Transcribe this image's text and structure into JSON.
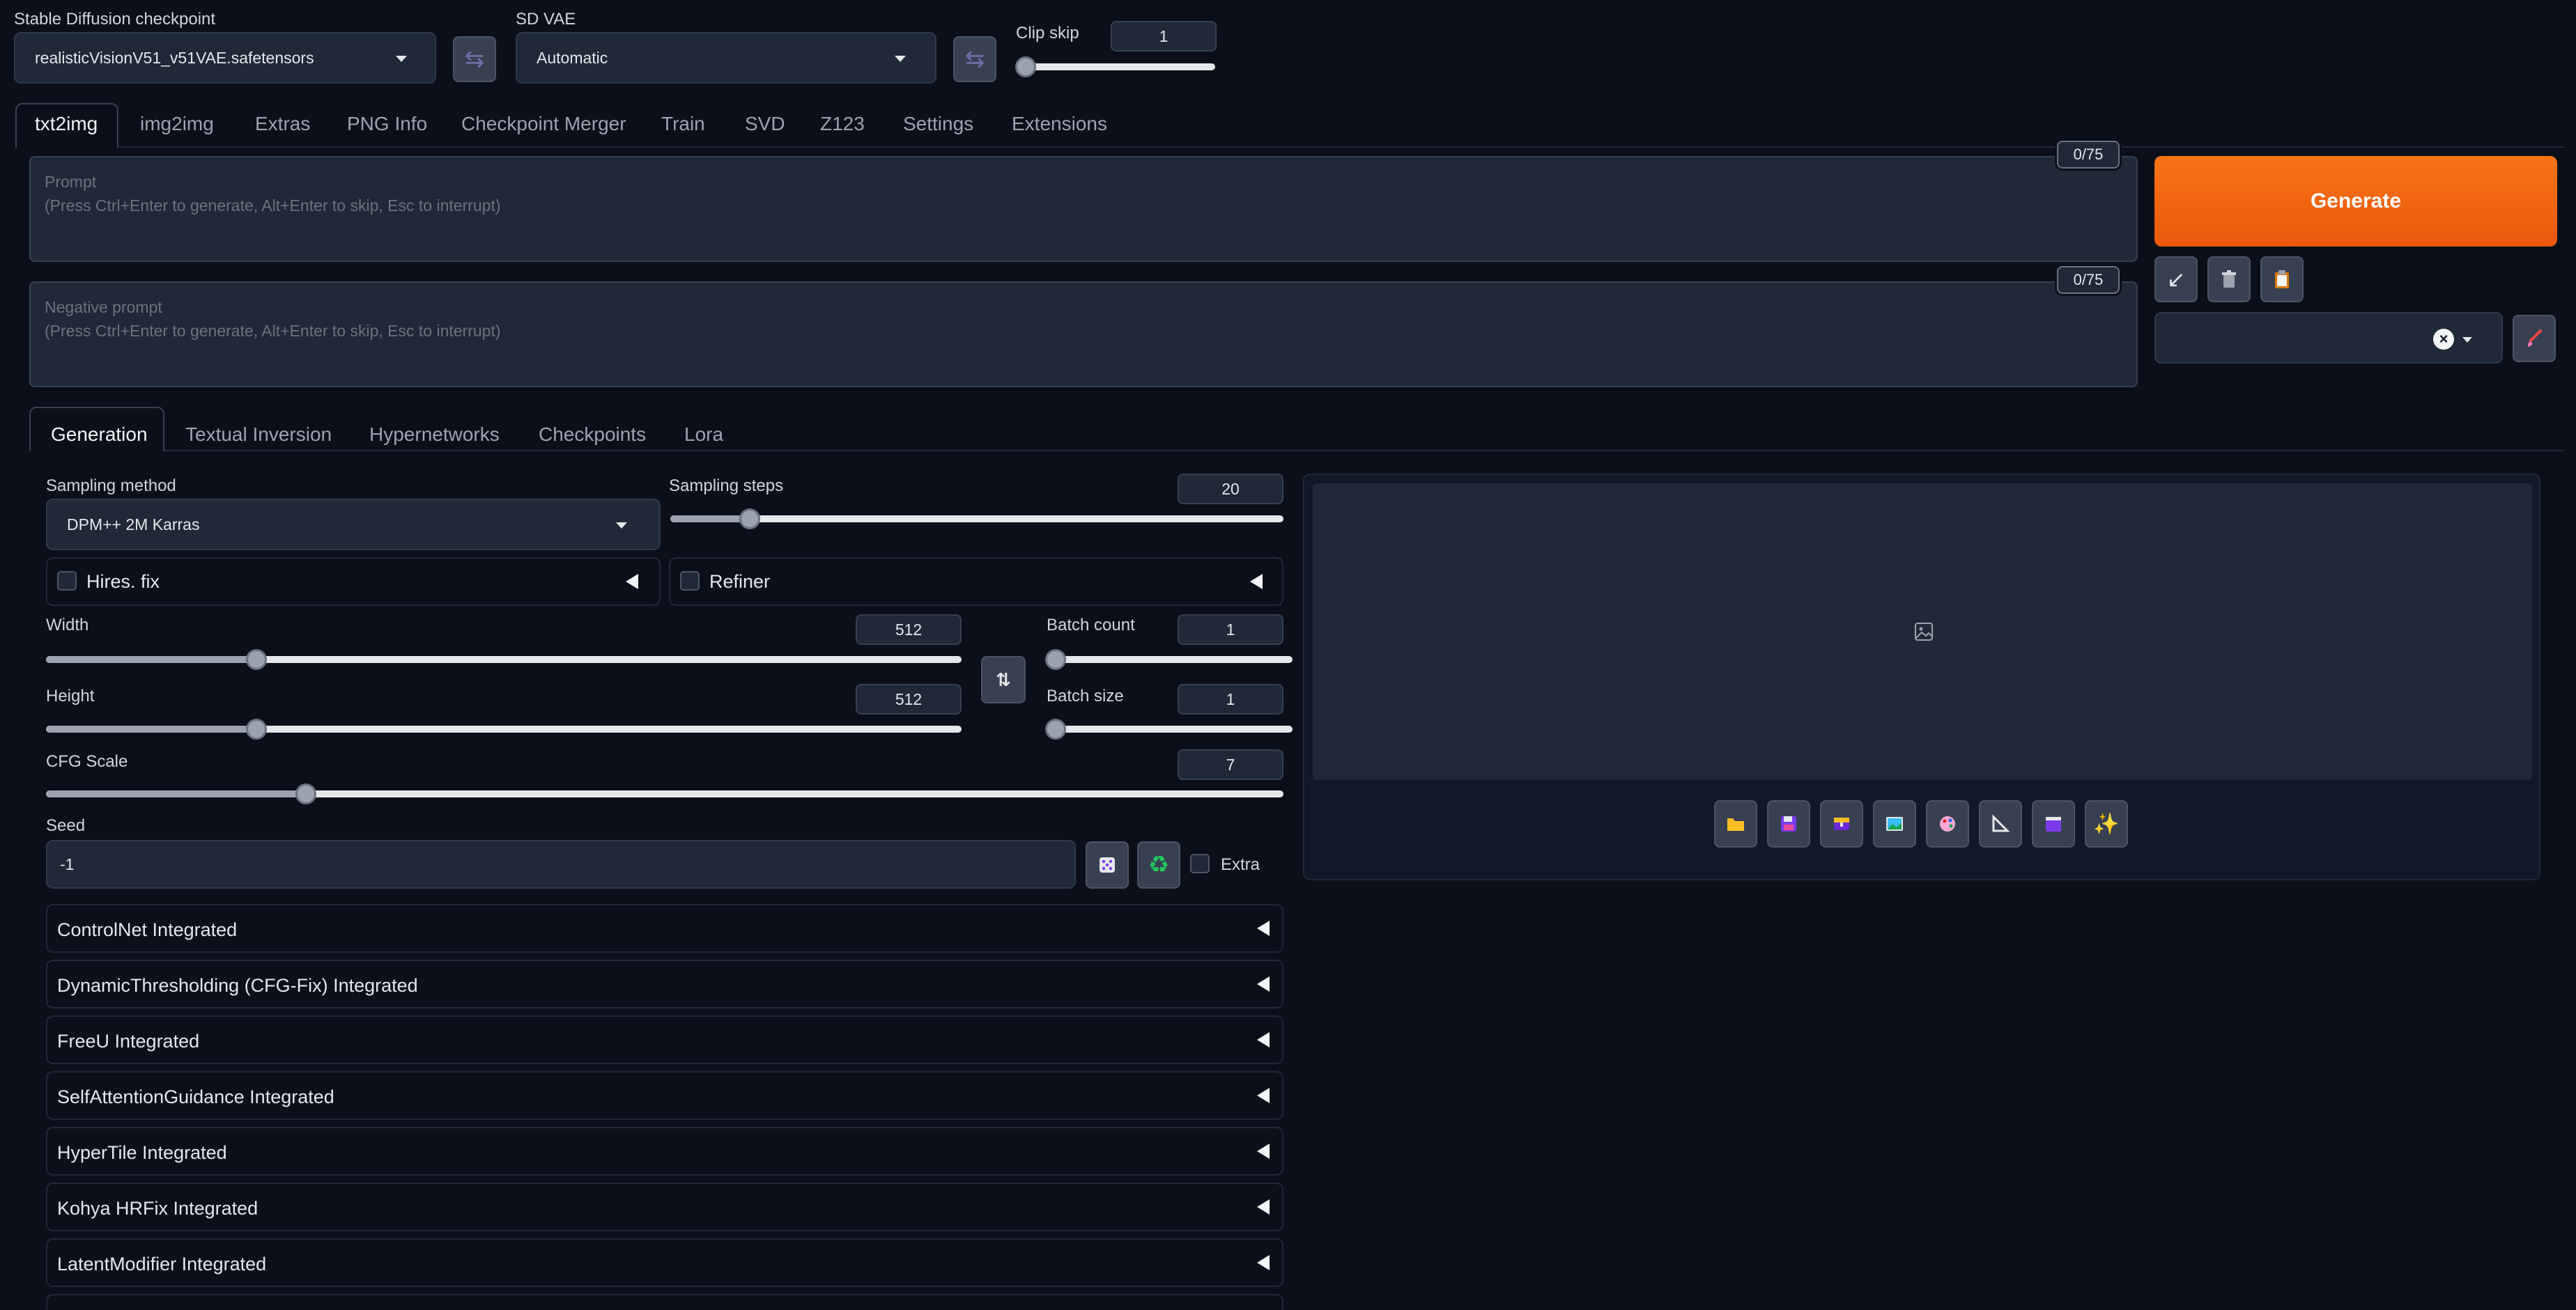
{
  "top": {
    "checkpoint_label": "Stable Diffusion checkpoint",
    "checkpoint_value": "realisticVisionV51_v51VAE.safetensors",
    "vae_label": "SD VAE",
    "vae_value": "Automatic",
    "clip_skip_label": "Clip skip",
    "clip_skip_value": "1",
    "clip_skip_level_fraction": 0
  },
  "tabs": [
    "txt2img",
    "img2img",
    "Extras",
    "PNG Info",
    "Checkpoint Merger",
    "Train",
    "SVD",
    "Z123",
    "Settings",
    "Extensions"
  ],
  "active_tab": "txt2img",
  "prompt": {
    "label": "Prompt",
    "hint": "(Press Ctrl+Enter to generate, Alt+Enter to skip, Esc to interrupt)",
    "token_count": "0/75"
  },
  "negative_prompt": {
    "label": "Negative prompt",
    "hint": "(Press Ctrl+Enter to generate, Alt+Enter to skip, Esc to interrupt)",
    "token_count": "0/75"
  },
  "generate_label": "Generate",
  "tool_icons": [
    "arrow-down-left-icon",
    "trash-icon",
    "clipboard-icon",
    "clear-x-icon",
    "brush-icon"
  ],
  "subtabs": [
    "Generation",
    "Textual Inversion",
    "Hypernetworks",
    "Checkpoints",
    "Lora"
  ],
  "active_subtab": "Generation",
  "params": {
    "sampling_method_label": "Sampling method",
    "sampling_method_value": "DPM++ 2M Karras",
    "sampling_steps_label": "Sampling steps",
    "sampling_steps_value": "20",
    "sampling_steps_fraction": 0.13,
    "hires_label": "Hires. fix",
    "refiner_label": "Refiner",
    "width_label": "Width",
    "width_value": "512",
    "width_fraction": 0.23,
    "height_label": "Height",
    "height_value": "512",
    "height_fraction": 0.23,
    "batch_count_label": "Batch count",
    "batch_count_value": "1",
    "batch_count_fraction": 0,
    "batch_size_label": "Batch size",
    "batch_size_value": "1",
    "batch_size_fraction": 0,
    "cfg_label": "CFG Scale",
    "cfg_value": "7",
    "cfg_fraction": 0.21,
    "seed_label": "Seed",
    "seed_value": "-1",
    "extra_label": "Extra"
  },
  "accordions": [
    "ControlNet Integrated",
    "DynamicThresholding (CFG-Fix) Integrated",
    "FreeU Integrated",
    "SelfAttentionGuidance Integrated",
    "HyperTile Integrated",
    "Kohya HRFix Integrated",
    "LatentModifier Integrated"
  ],
  "output_toolbar_icons": [
    "folder-icon",
    "save-icon",
    "zip-icon",
    "send-to-img2img-icon",
    "send-to-inpaint-icon",
    "send-to-extras-icon",
    "send-to-svd-icon",
    "sparkle-icon"
  ],
  "colors": {
    "background": "#0b0f19",
    "generate": "#f97316",
    "panel": "#1f2937"
  }
}
